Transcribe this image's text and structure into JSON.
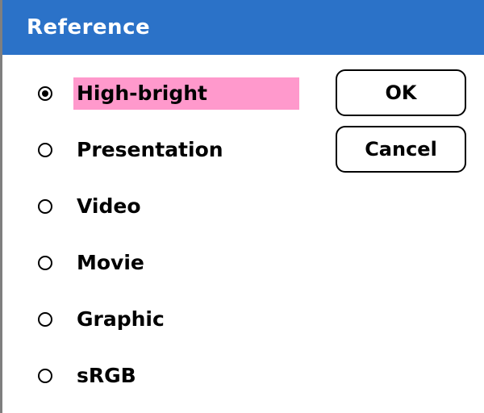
{
  "dialog": {
    "title": "Reference"
  },
  "options": [
    {
      "label": "High-bright",
      "selected": true
    },
    {
      "label": "Presentation",
      "selected": false
    },
    {
      "label": "Video",
      "selected": false
    },
    {
      "label": "Movie",
      "selected": false
    },
    {
      "label": "Graphic",
      "selected": false
    },
    {
      "label": "sRGB",
      "selected": false
    }
  ],
  "buttons": {
    "ok_label": "OK",
    "cancel_label": "Cancel"
  },
  "colors": {
    "titlebar": "#2b72c8",
    "title_text": "#ffffff",
    "selection_highlight": "#ff99cc"
  }
}
